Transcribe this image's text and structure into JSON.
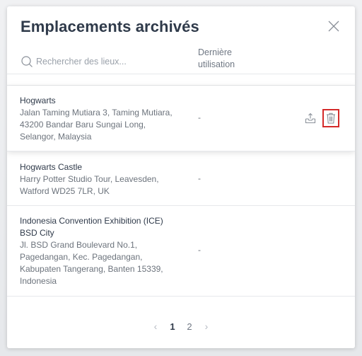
{
  "modal": {
    "title": "Emplacements archivés"
  },
  "search": {
    "placeholder": "Rechercher des lieux..."
  },
  "columns": {
    "last_used_line1": "Dernière",
    "last_used_line2": "utilisation"
  },
  "locations": [
    {
      "name": "Hogwarts",
      "address": [
        "Jalan Taming Mutiara 3, Taming Mutiara,",
        "43200 Bandar Baru Sungai Long,",
        "Selangor, Malaysia"
      ],
      "last_used": "-"
    },
    {
      "name": "Hogwarts Castle",
      "address": [
        "Harry Potter Studio Tour, Leavesden,",
        "Watford WD25 7LR, UK"
      ],
      "last_used": "-"
    },
    {
      "name": "Indonesia Convention Exhibition (ICE)",
      "name2": "BSD City",
      "address": [
        "Jl. BSD Grand Boulevard No.1,",
        "Pagedangan, Kec. Pagedangan,",
        "Kabupaten Tangerang, Banten 15339,",
        "Indonesia"
      ],
      "last_used": "-"
    }
  ],
  "pagination": {
    "prev": "‹",
    "pages": [
      "1",
      "2"
    ],
    "current": "1",
    "next": "›"
  },
  "colors": {
    "accent_red": "#d42a2a",
    "title": "#2f3a4a",
    "muted": "#6c737c"
  },
  "icons": {
    "close": "close-icon",
    "search": "search-icon",
    "unarchive": "unarchive-icon",
    "delete": "trash-icon"
  }
}
